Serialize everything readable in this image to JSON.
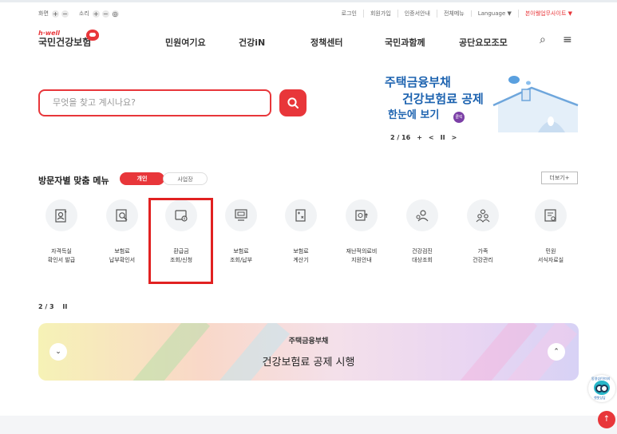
{
  "topbar": {
    "screen_label": "화면",
    "sound_label": "소리",
    "plus": "+",
    "minus": "−",
    "sound_toggle": "◎",
    "links": [
      "로그인",
      "회원가입",
      "인증서안내",
      "전체메뉴",
      "Language ▼"
    ],
    "related_sites": "본아웰업무사이트 ▼"
  },
  "header": {
    "logo_sub": "h·well",
    "logo_main": "국민건강보험",
    "nav": [
      "민원여기요",
      "건강iN",
      "정책센터",
      "국민과함께",
      "공단요모조모"
    ],
    "search_icon": "⌕",
    "menu_icon": "≡"
  },
  "search": {
    "placeholder": "무엇을 찾고 계시나요?"
  },
  "banner": {
    "line1": "주택금융부채",
    "line2": "건강보험료 공제",
    "line3": "한눈에 보기",
    "click_badge": "클릭",
    "pager": "2 / 16",
    "plus": "+",
    "prev": "<",
    "pause": "II",
    "next": ">"
  },
  "quick_menu": {
    "title": "방문자별 맞춤 메뉴",
    "tab_personal": "개인",
    "tab_business": "사업장",
    "more": "더보기+",
    "items": [
      {
        "line1": "자격득실",
        "line2": "확인서 발급",
        "icon": "certificate-icon"
      },
      {
        "line1": "보험료",
        "line2": "납부확인서",
        "icon": "receipt-search-icon"
      },
      {
        "line1": "환급금",
        "line2": "조회/신청",
        "icon": "refund-icon"
      },
      {
        "line1": "보험료",
        "line2": "조회/납부",
        "icon": "payment-icon"
      },
      {
        "line1": "보험료",
        "line2": "계산기",
        "icon": "calculator-icon"
      },
      {
        "line1": "재난적의료비",
        "line2": "지원안내",
        "icon": "medical-support-icon"
      },
      {
        "line1": "건강검진",
        "line2": "대상조회",
        "icon": "checkup-search-icon"
      },
      {
        "line1": "가족",
        "line2": "건강관리",
        "icon": "family-icon"
      },
      {
        "line1": "민원",
        "line2": "서식자료실",
        "icon": "forms-icon"
      }
    ]
  },
  "promo": {
    "pager": "2 / 3",
    "pause": "II",
    "line1": "주택금융부채",
    "line2": "건강보험료 공제 시행",
    "prev": "⌄",
    "next": "⌃"
  },
  "floating": {
    "mascot_top": "동영상/이미지",
    "mascot_bottom": "챗봇상담",
    "top_button": "↑"
  },
  "colors": {
    "brand_red": "#e8363a",
    "banner_blue": "#1d63b0",
    "highlight": "#e12121"
  }
}
